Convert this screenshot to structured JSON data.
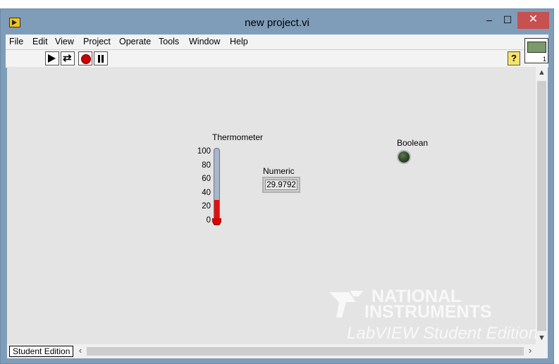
{
  "window": {
    "title": "new project.vi"
  },
  "menu": [
    "File",
    "Edit",
    "View",
    "Project",
    "Operate",
    "Tools",
    "Window",
    "Help"
  ],
  "toolbar": {
    "run": "run-arrow-icon",
    "run_continuously": "run-continuously-icon",
    "abort": "abort-stop-icon",
    "pause": "pause-icon",
    "help": "?"
  },
  "front_panel": {
    "thermometer": {
      "label": "Thermometer",
      "ticks": [
        "100",
        "80",
        "60",
        "40",
        "20",
        "0"
      ],
      "value": 29.9792,
      "range": [
        0,
        100
      ],
      "fill_color": "#e01010"
    },
    "numeric": {
      "label": "Numeric",
      "value": "29.9792"
    },
    "boolean": {
      "label": "Boolean",
      "state": "off",
      "color": "#2f4628"
    }
  },
  "status": {
    "edition": "Student Edition"
  },
  "watermark": {
    "line1": "NATIONAL",
    "line2": "INSTRUMENTS",
    "line3": "LabVIEW Student Edition"
  }
}
